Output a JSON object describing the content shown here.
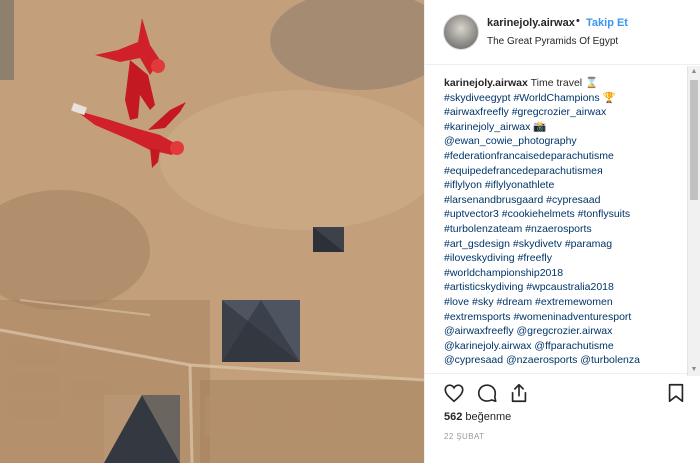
{
  "header": {
    "username": "karinejoly.airwax",
    "separator": "•",
    "follow_label": "Takip Et",
    "location": "The Great Pyramids Of Egypt"
  },
  "caption": {
    "username": "karinejoly.airwax",
    "first_line_text": " Time travel ⌛",
    "lines": [
      "#skydiveegypt #WorldChampions 🏆",
      "#airwaxfreefly #gregcrozier_airwax",
      "#karinejoly_airwax 📸",
      "@ewan_cowie_photography",
      "#federationfrancaisedeparachutisme",
      "#equipedefrancedeparachutismeя",
      "#iflylyon #iflylyonathlete",
      "#larsenandbrusgaard #cypresaad",
      "#uptvector3 #cookiehelmets #tonflysuits",
      "#turbolenzateam #nzaerosports",
      "#art_gsdesign #skydivetv #paramag",
      "#iloveskydiving #freefly",
      "#worldchampionship2018",
      "#artisticskydiving #wpcaustralia2018",
      "#love #sky #dream #extremewomen",
      "#extremsports #womeninadventuresport",
      "@airwaxfreefly @gregcrozier.airwax",
      "@karinejoly.airwax @ffparachutisme",
      "@cypresaad @nzaerosports @turbolenza"
    ]
  },
  "actions": {
    "like_icon": "heart-outline",
    "comment_icon": "speech-bubble",
    "share_icon": "upload-arrow",
    "save_icon": "bookmark-outline"
  },
  "likes": {
    "count": "562",
    "label": " beğenme"
  },
  "date": "22 ŞUBAT",
  "colors": {
    "follow": "#3897f0",
    "hashtag": "#003569",
    "text": "#262626",
    "muted": "#999999"
  }
}
